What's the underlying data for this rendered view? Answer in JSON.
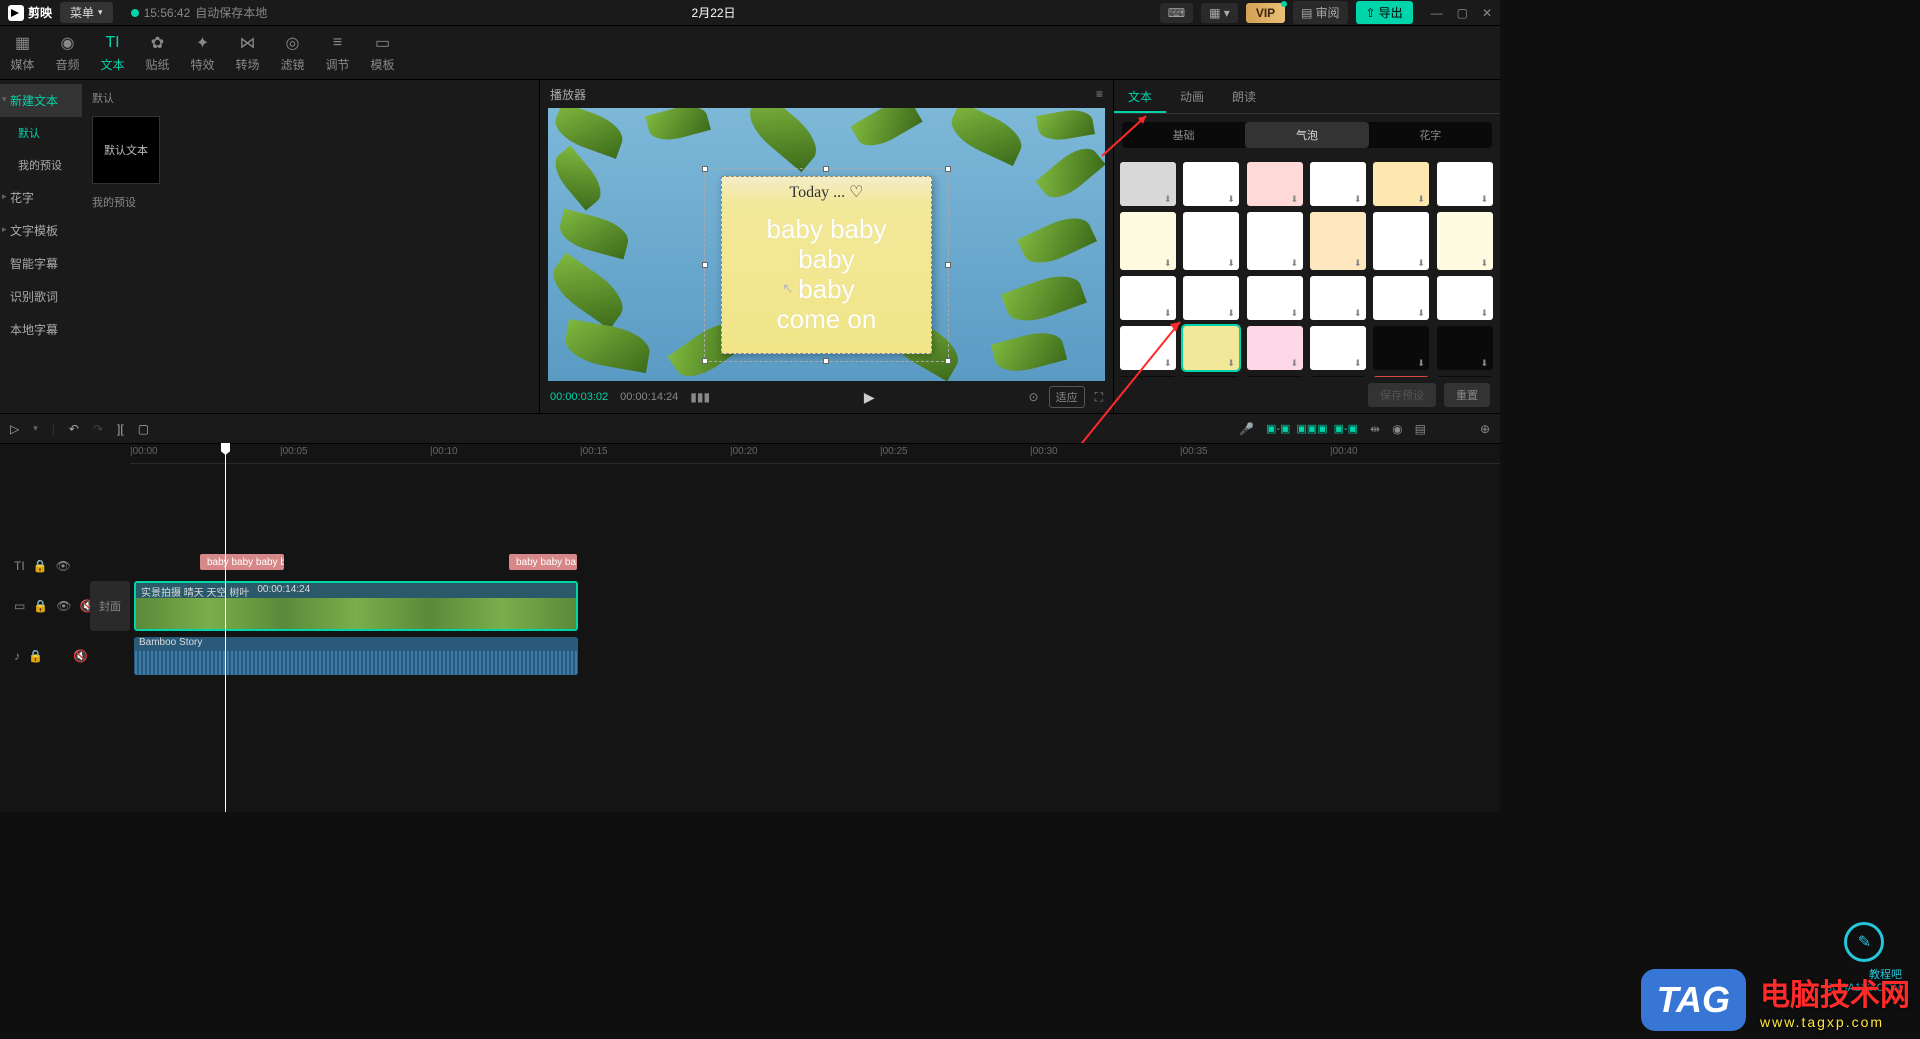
{
  "titlebar": {
    "logo": "剪映",
    "menu": "菜单",
    "autosave_time": "15:56:42",
    "autosave_text": "自动保存本地",
    "project_title": "2月22日",
    "vip": "VIP",
    "review": "审阅",
    "export": "导出"
  },
  "nav": {
    "tabs": [
      "媒体",
      "音频",
      "文本",
      "贴纸",
      "特效",
      "转场",
      "滤镜",
      "调节",
      "模板"
    ],
    "active_index": 2
  },
  "left": {
    "items": [
      {
        "label": "新建文本",
        "active": true,
        "expand": true
      },
      {
        "label": "默认",
        "sub": true
      },
      {
        "label": "我的预设",
        "sub": true
      },
      {
        "label": "花字",
        "expand": true
      },
      {
        "label": "文字模板",
        "expand": true
      },
      {
        "label": "智能字幕"
      },
      {
        "label": "识别歌词"
      },
      {
        "label": "本地字幕"
      }
    ],
    "section1": "默认",
    "thumb_text": "默认文本",
    "section2": "我的预设"
  },
  "player": {
    "header": "播放器",
    "note_header": "Today ... ♡",
    "note_body": "baby baby\nbaby\nbaby\ncome on",
    "time_current": "00:00:03:02",
    "time_total": "00:00:14:24",
    "scale": "适应"
  },
  "inspector": {
    "tabs": [
      "文本",
      "动画",
      "朗读"
    ],
    "active_tab": 0,
    "subtabs": [
      "基础",
      "气泡",
      "花字"
    ],
    "active_sub": 1,
    "save_preset": "保存预设",
    "reset": "重置"
  },
  "toolbar": {
    "left_icons": [
      "▷",
      "↶",
      "↷",
      "⎿⏌",
      "▢"
    ]
  },
  "timeline": {
    "ticks": [
      "00:00",
      "00:05",
      "00:10",
      "00:15",
      "00:20",
      "00:25",
      "00:30",
      "00:35",
      "00:40"
    ],
    "cover": "封面",
    "text_clip": "baby baby baby b",
    "text_clip2": "baby baby ba",
    "video_name": "实景拍摄 晴天 天空 树叶",
    "video_dur": "00:00:14:24",
    "audio_name": "Bamboo Story"
  },
  "watermark": {
    "tag": "TAG",
    "main": "电脑技术网",
    "url": "www.tagxp.com",
    "jcb_label": "教程吧",
    "jcb_url": "JCBA123.COM"
  }
}
